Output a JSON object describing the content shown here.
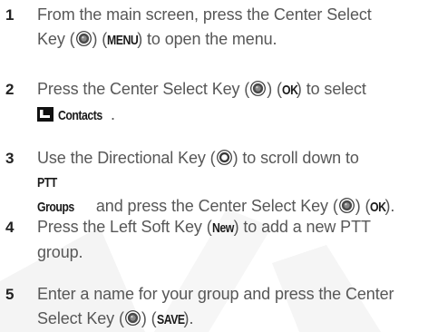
{
  "steps": [
    {
      "number": "1",
      "t1": "From the main screen, press the Center Select",
      "t2": "Key (",
      "t3": ") (",
      "b1": "MENU",
      "t4": ") to open the menu."
    },
    {
      "number": "2",
      "t1": "Press the Center Select Key (",
      "t2": ") (",
      "b1": "OK",
      "t3": ") to select",
      "b2": "Contacts",
      "t4": "."
    },
    {
      "number": "3",
      "t1": "Use the Directional Key (",
      "t2": ") to scroll down to",
      "b1": "PTT Groups",
      "t3": " and press the Center Select Key (",
      "t4": ") (",
      "b2": "OK",
      "t5": ")."
    },
    {
      "number": "4",
      "t1": "Press the Left Soft Key (",
      "b1": "New",
      "t2": ") to add a new PTT",
      "t3": "group."
    },
    {
      "number": "5",
      "t1": "Enter a name for your group and press the Center",
      "t2": "Select Key (",
      "t3": ") (",
      "b1": "SAVE",
      "t4": ")."
    }
  ],
  "icons": {
    "center_select": "center-select-key-icon",
    "directional": "directional-key-icon",
    "contacts": "contacts-icon"
  }
}
